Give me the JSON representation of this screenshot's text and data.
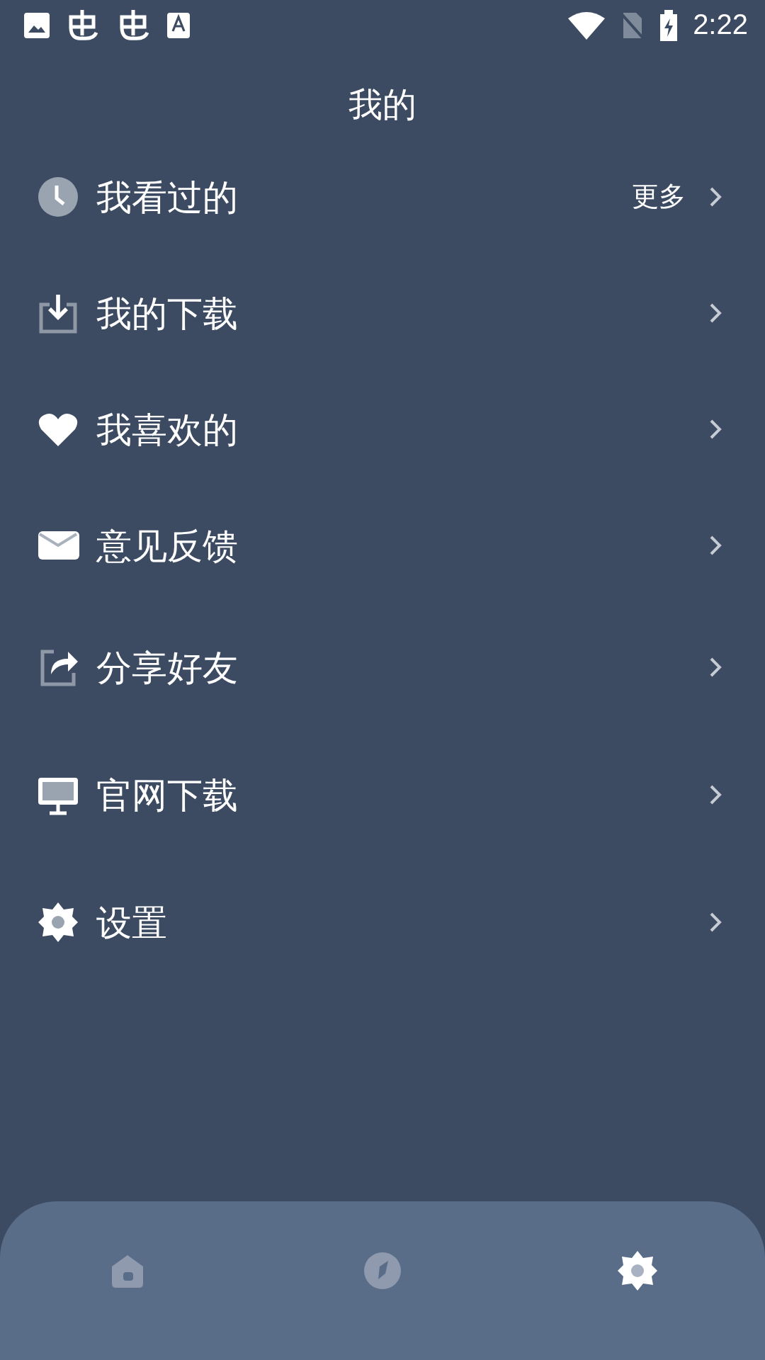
{
  "status_bar": {
    "time": "2:22"
  },
  "title": "我的",
  "menu": [
    {
      "label": "我看过的",
      "extra": "更多"
    },
    {
      "label": "我的下载"
    },
    {
      "label": "我喜欢的"
    },
    {
      "label": "意见反馈"
    },
    {
      "label": "分享好友"
    },
    {
      "label": "官网下载"
    },
    {
      "label": "设置"
    }
  ],
  "bottom_nav": [
    {
      "selected": false
    },
    {
      "selected": false
    },
    {
      "selected": true
    }
  ]
}
